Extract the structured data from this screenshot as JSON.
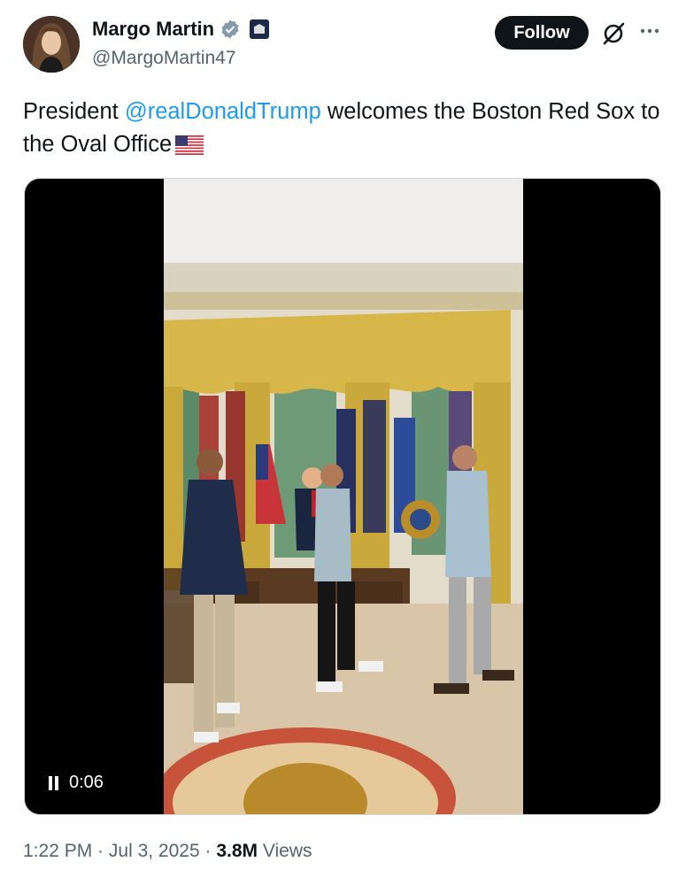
{
  "author": {
    "display_name": "Margo Martin",
    "handle": "@MargoMartin47",
    "avatar": "avatar-photo",
    "verified_icon": "verified-badge-icon",
    "affiliation_icon": "white-house-badge-icon"
  },
  "actions": {
    "follow_label": "Follow",
    "grok_icon": "grok-icon",
    "more_icon": "more-options-icon"
  },
  "tweet": {
    "text_prefix": "President ",
    "mention": "@realDonaldTrump",
    "text_suffix": " welcomes the Boston Red Sox to the Oval Office",
    "emoji": "us-flag-emoji"
  },
  "video": {
    "play_state_icon": "pause-icon",
    "elapsed": "0:06"
  },
  "meta": {
    "time": "1:22 PM",
    "date": "Jul 3, 2025",
    "views_count": "3.8M",
    "views_label": "Views",
    "separator": " · "
  },
  "colors": {
    "text": "#0f1419",
    "secondary": "#536471",
    "link": "#1d9bf0",
    "verified": "#829aab",
    "button": "#0f1419"
  }
}
